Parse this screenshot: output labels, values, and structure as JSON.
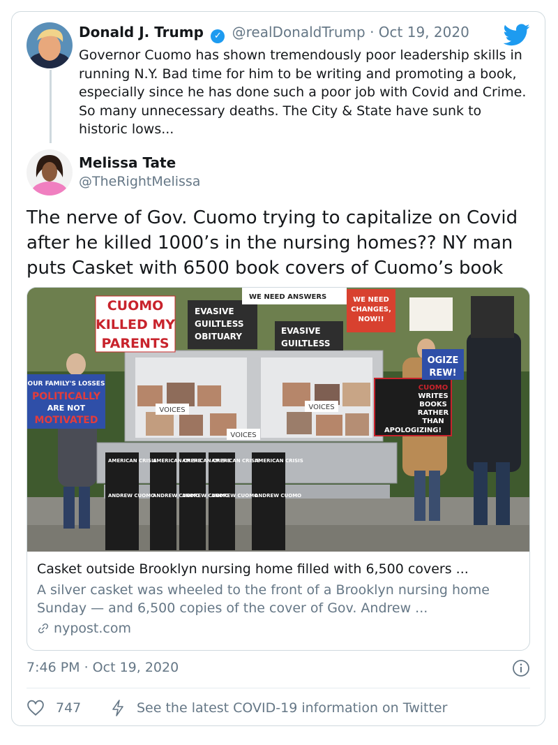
{
  "quoted_tweet": {
    "name": "Donald J. Trump",
    "handle": "@realDonaldTrump",
    "separator": "·",
    "date": "Oct 19, 2020",
    "text": "Governor Cuomo has shown tremendously poor leadership skills in running N.Y. Bad time for him to be writing and promoting a book, especially since he has done such a poor job with Covid and Crime. So many unnecessary deaths. The City & State have sunk to historic lows...",
    "verified_icon": "verified-check-icon"
  },
  "author": {
    "name": "Melissa Tate",
    "handle": "@TheRightMelissa"
  },
  "tweet_text": "The nerve of Gov. Cuomo trying to capitalize on Covid after he killed 1000’s in the nursing homes?? NY man puts Casket with 6500 book covers of Cuomo’s book",
  "link_card": {
    "photo_signs": {
      "sign1": "CUOMO KILLED MY PARENTS",
      "sign1_line1": "CUOMO",
      "sign1_line2": "KILLED MY",
      "sign1_line3": "PARENTS",
      "sign2_line1": "EVASIVE",
      "sign2_line2": "GUILTLESS",
      "sign2_line3": "OBITUARY",
      "sign3": "WE NEED ANSWERS",
      "sign4_line1": "WE NEED",
      "sign4_line2": "CHANGES,",
      "sign4_line3": "NOW!!",
      "sign5_line1": "OUR FAMILY'S LOSSES",
      "sign5_line2": "POLITICALLY",
      "sign5_line3": "ARE NOT",
      "sign5_line4": "MOTIVATED",
      "sign6_line1": "CUOMO",
      "sign6_line2": "WRITES",
      "sign6_line3": "BOOKS",
      "sign6_line4": "RATHER",
      "sign6_line5": "THAN",
      "sign6_line6": "APOLOGIZING!",
      "sign7_line1": "OGIZE",
      "sign7_line2": "REW!",
      "sign8_line1": "EVASIVE",
      "sign8_line2": "GUILTLESS",
      "voices": "VOICES",
      "book_title": "AMERICAN CRISIS",
      "book_author": "ANDREW CUOMO"
    },
    "title": "Casket outside Brooklyn nursing home filled with 6,500 covers ...",
    "description": "A silver casket was wheeled to the front of a Brooklyn nursing home Sunday — and 6,500 copies of the cover of Gov. Andrew ...",
    "domain": "nypost.com",
    "link_icon": "link-icon"
  },
  "timestamp": "7:46 PM · Oct 19, 2020",
  "actions": {
    "likes": "747",
    "covid_text": "See the latest COVID-19 information on Twitter"
  },
  "colors": {
    "twitter_blue": "#1d9bf0",
    "text": "#14171a",
    "muted": "#657786",
    "border": "#cfd9de"
  }
}
